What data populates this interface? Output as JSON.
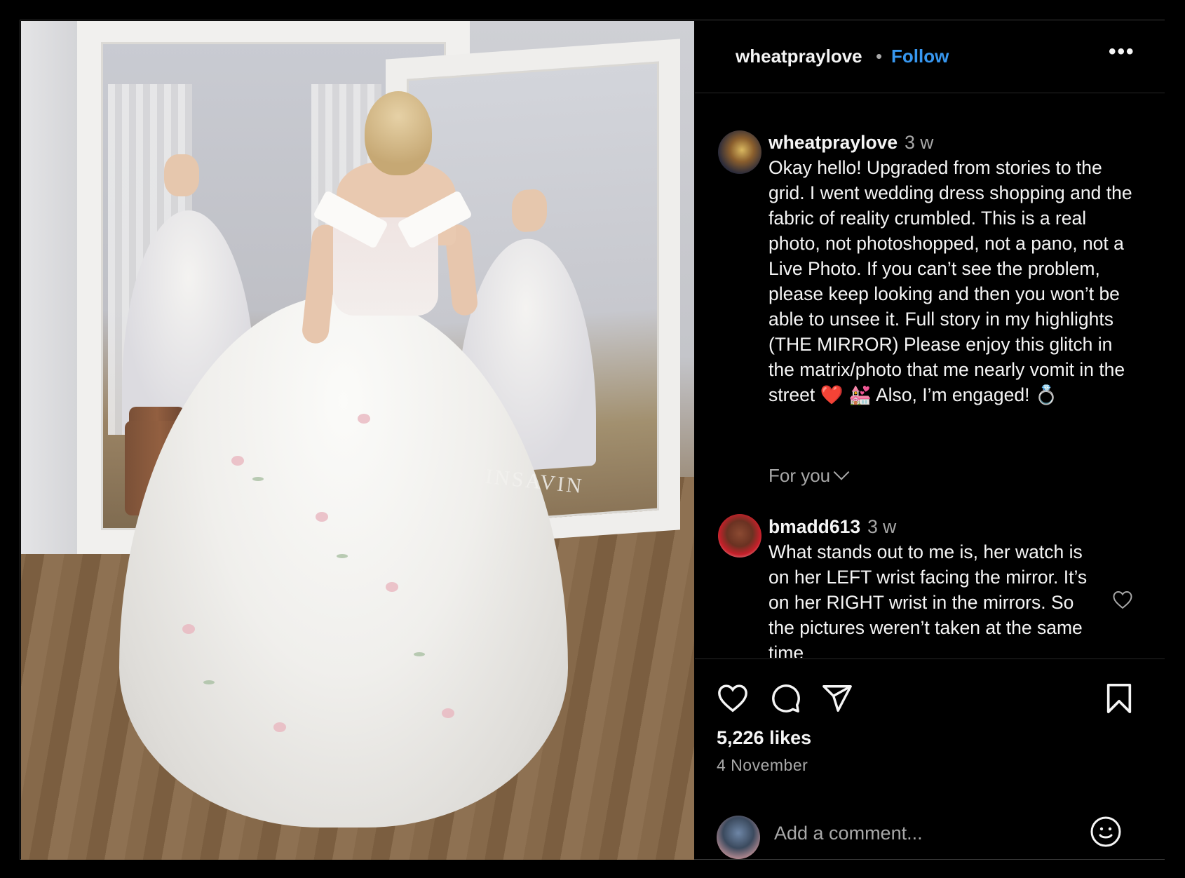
{
  "header": {
    "username": "wheatpraylove",
    "separator": "•",
    "follow_label": "Follow",
    "more_label": "•••"
  },
  "photo": {
    "brand_text": "INSAVIN"
  },
  "caption": {
    "username": "wheatpraylove",
    "time": "3 w",
    "text": "Okay hello! Upgraded from stories to the grid. I went wedding dress shopping and the fabric of reality crumbled. This is a real photo, not photoshopped, not a pano, not a Live Photo. If you can’t see the problem, please keep looking and then you won’t be able to unsee it. Full story in my highlights (THE MIRROR) Please enjoy this glitch in the matrix/photo that me nearly vomit in the street",
    "emoji_heart": "❤️",
    "emoji_chapel": "💒",
    "text_end": "Also, I’m engaged!",
    "emoji_ring": "💍"
  },
  "for_you": {
    "label": "For you"
  },
  "comment": {
    "username": "bmadd613",
    "time": "3 w",
    "text": "What stands out to me is, her watch is on her LEFT wrist facing the mirror. It’s on her RIGHT wrist in the mirrors. So the pictures weren’t taken at the same time"
  },
  "actions": {
    "likes": "5,226 likes",
    "date": "4 November"
  },
  "composer": {
    "placeholder": "Add a comment..."
  },
  "colors": {
    "accent": "#3797f0",
    "muted": "#a8a8a8",
    "background": "#000000"
  }
}
